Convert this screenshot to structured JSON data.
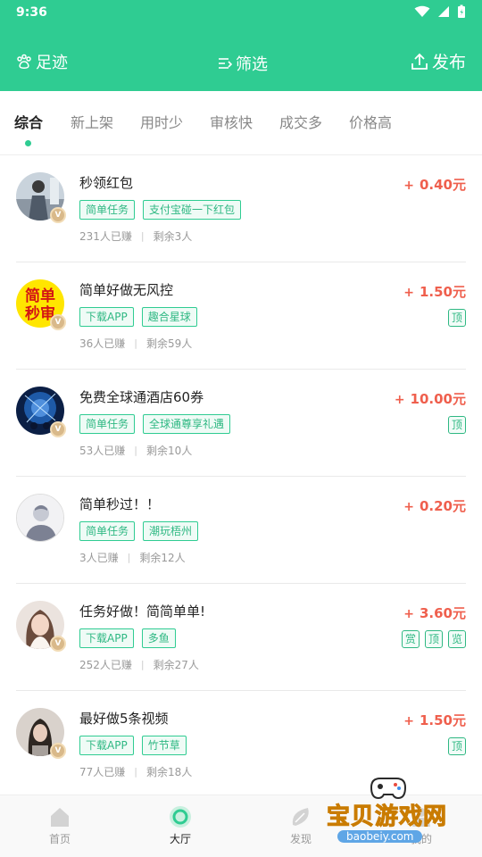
{
  "status_bar": {
    "time": "9:36"
  },
  "header": {
    "footprint_label": "足迹",
    "filter_label": "筛选",
    "publish_label": "发布",
    "bg_color": "#2fcc92"
  },
  "tabs": [
    {
      "label": "综合",
      "active": true
    },
    {
      "label": "新上架"
    },
    {
      "label": "用时少"
    },
    {
      "label": "审核快"
    },
    {
      "label": "成交多"
    },
    {
      "label": "价格高"
    }
  ],
  "tasks": [
    {
      "title": "秒领红包",
      "tags": [
        "简单任务",
        "支付宝碰一下红包"
      ],
      "earned": "231人已赚",
      "remaining": "剩余3人",
      "price": "0.40元",
      "badges": []
    },
    {
      "title": "简单好做无风控",
      "tags": [
        "下载APP",
        "趣合星球"
      ],
      "earned": "36人已赚",
      "remaining": "剩余59人",
      "price": "1.50元",
      "badges": [
        "顶"
      ],
      "avatar_text": "简单秒审"
    },
    {
      "title": "免费全球通酒店60券",
      "tags": [
        "简单任务",
        "全球通尊享礼遇"
      ],
      "earned": "53人已赚",
      "remaining": "剩余10人",
      "price": "10.00元",
      "badges": [
        "顶"
      ]
    },
    {
      "title": "简单秒过！！",
      "tags": [
        "简单任务",
        "潮玩梧州"
      ],
      "earned": "3人已赚",
      "remaining": "剩余12人",
      "price": "0.20元",
      "badges": []
    },
    {
      "title": "任务好做！简简单单!",
      "tags": [
        "下载APP",
        "多鱼"
      ],
      "earned": "252人已赚",
      "remaining": "剩余27人",
      "price": "3.60元",
      "badges": [
        "赏",
        "顶",
        "览"
      ]
    },
    {
      "title": "最好做5条视频",
      "tags": [
        "下载APP",
        "竹节草"
      ],
      "earned": "77人已赚",
      "remaining": "剩余18人",
      "price": "1.50元",
      "badges": [
        "顶"
      ]
    }
  ],
  "price_prefix": "+",
  "bottom_nav": [
    {
      "label": "首页",
      "icon": "home-icon"
    },
    {
      "label": "大厅",
      "icon": "hall-icon",
      "active": true
    },
    {
      "label": "发现",
      "icon": "discover-icon"
    },
    {
      "label": "我的",
      "icon": "profile-icon"
    }
  ],
  "watermark": {
    "text": "宝贝游戏网",
    "url": "baobeiy.com"
  },
  "colors": {
    "accent": "#2fcc92",
    "price": "#ef5f4d"
  }
}
